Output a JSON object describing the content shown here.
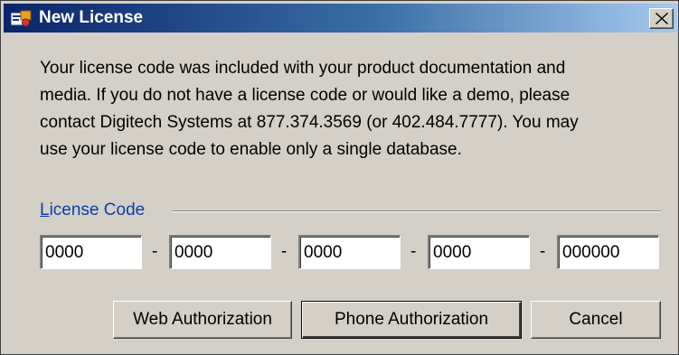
{
  "window": {
    "title": "New License",
    "close_label": "×"
  },
  "message": "Your license code was included with your product documentation and\nmedia.  If you do not have a license code or would like a demo, please\ncontact Digitech Systems at 877.374.3569 (or 402.484.7777).  You may\nuse your license code to enable only a single database.",
  "license": {
    "group_label_first": "L",
    "group_label_rest": "icense Code",
    "fields": [
      "0000",
      "0000",
      "0000",
      "0000",
      "000000"
    ],
    "separator": "-"
  },
  "buttons": {
    "web": "Web Authorization",
    "phone": "Phone Authorization",
    "cancel": "Cancel"
  },
  "colors": {
    "title_bar_start": "#0a246a",
    "title_bar_end": "#a6caf0",
    "dialog_face": "#d4d0c8",
    "group_label": "#0b3fa8"
  },
  "icons": {
    "app": "license-app-icon",
    "close": "close-icon"
  }
}
